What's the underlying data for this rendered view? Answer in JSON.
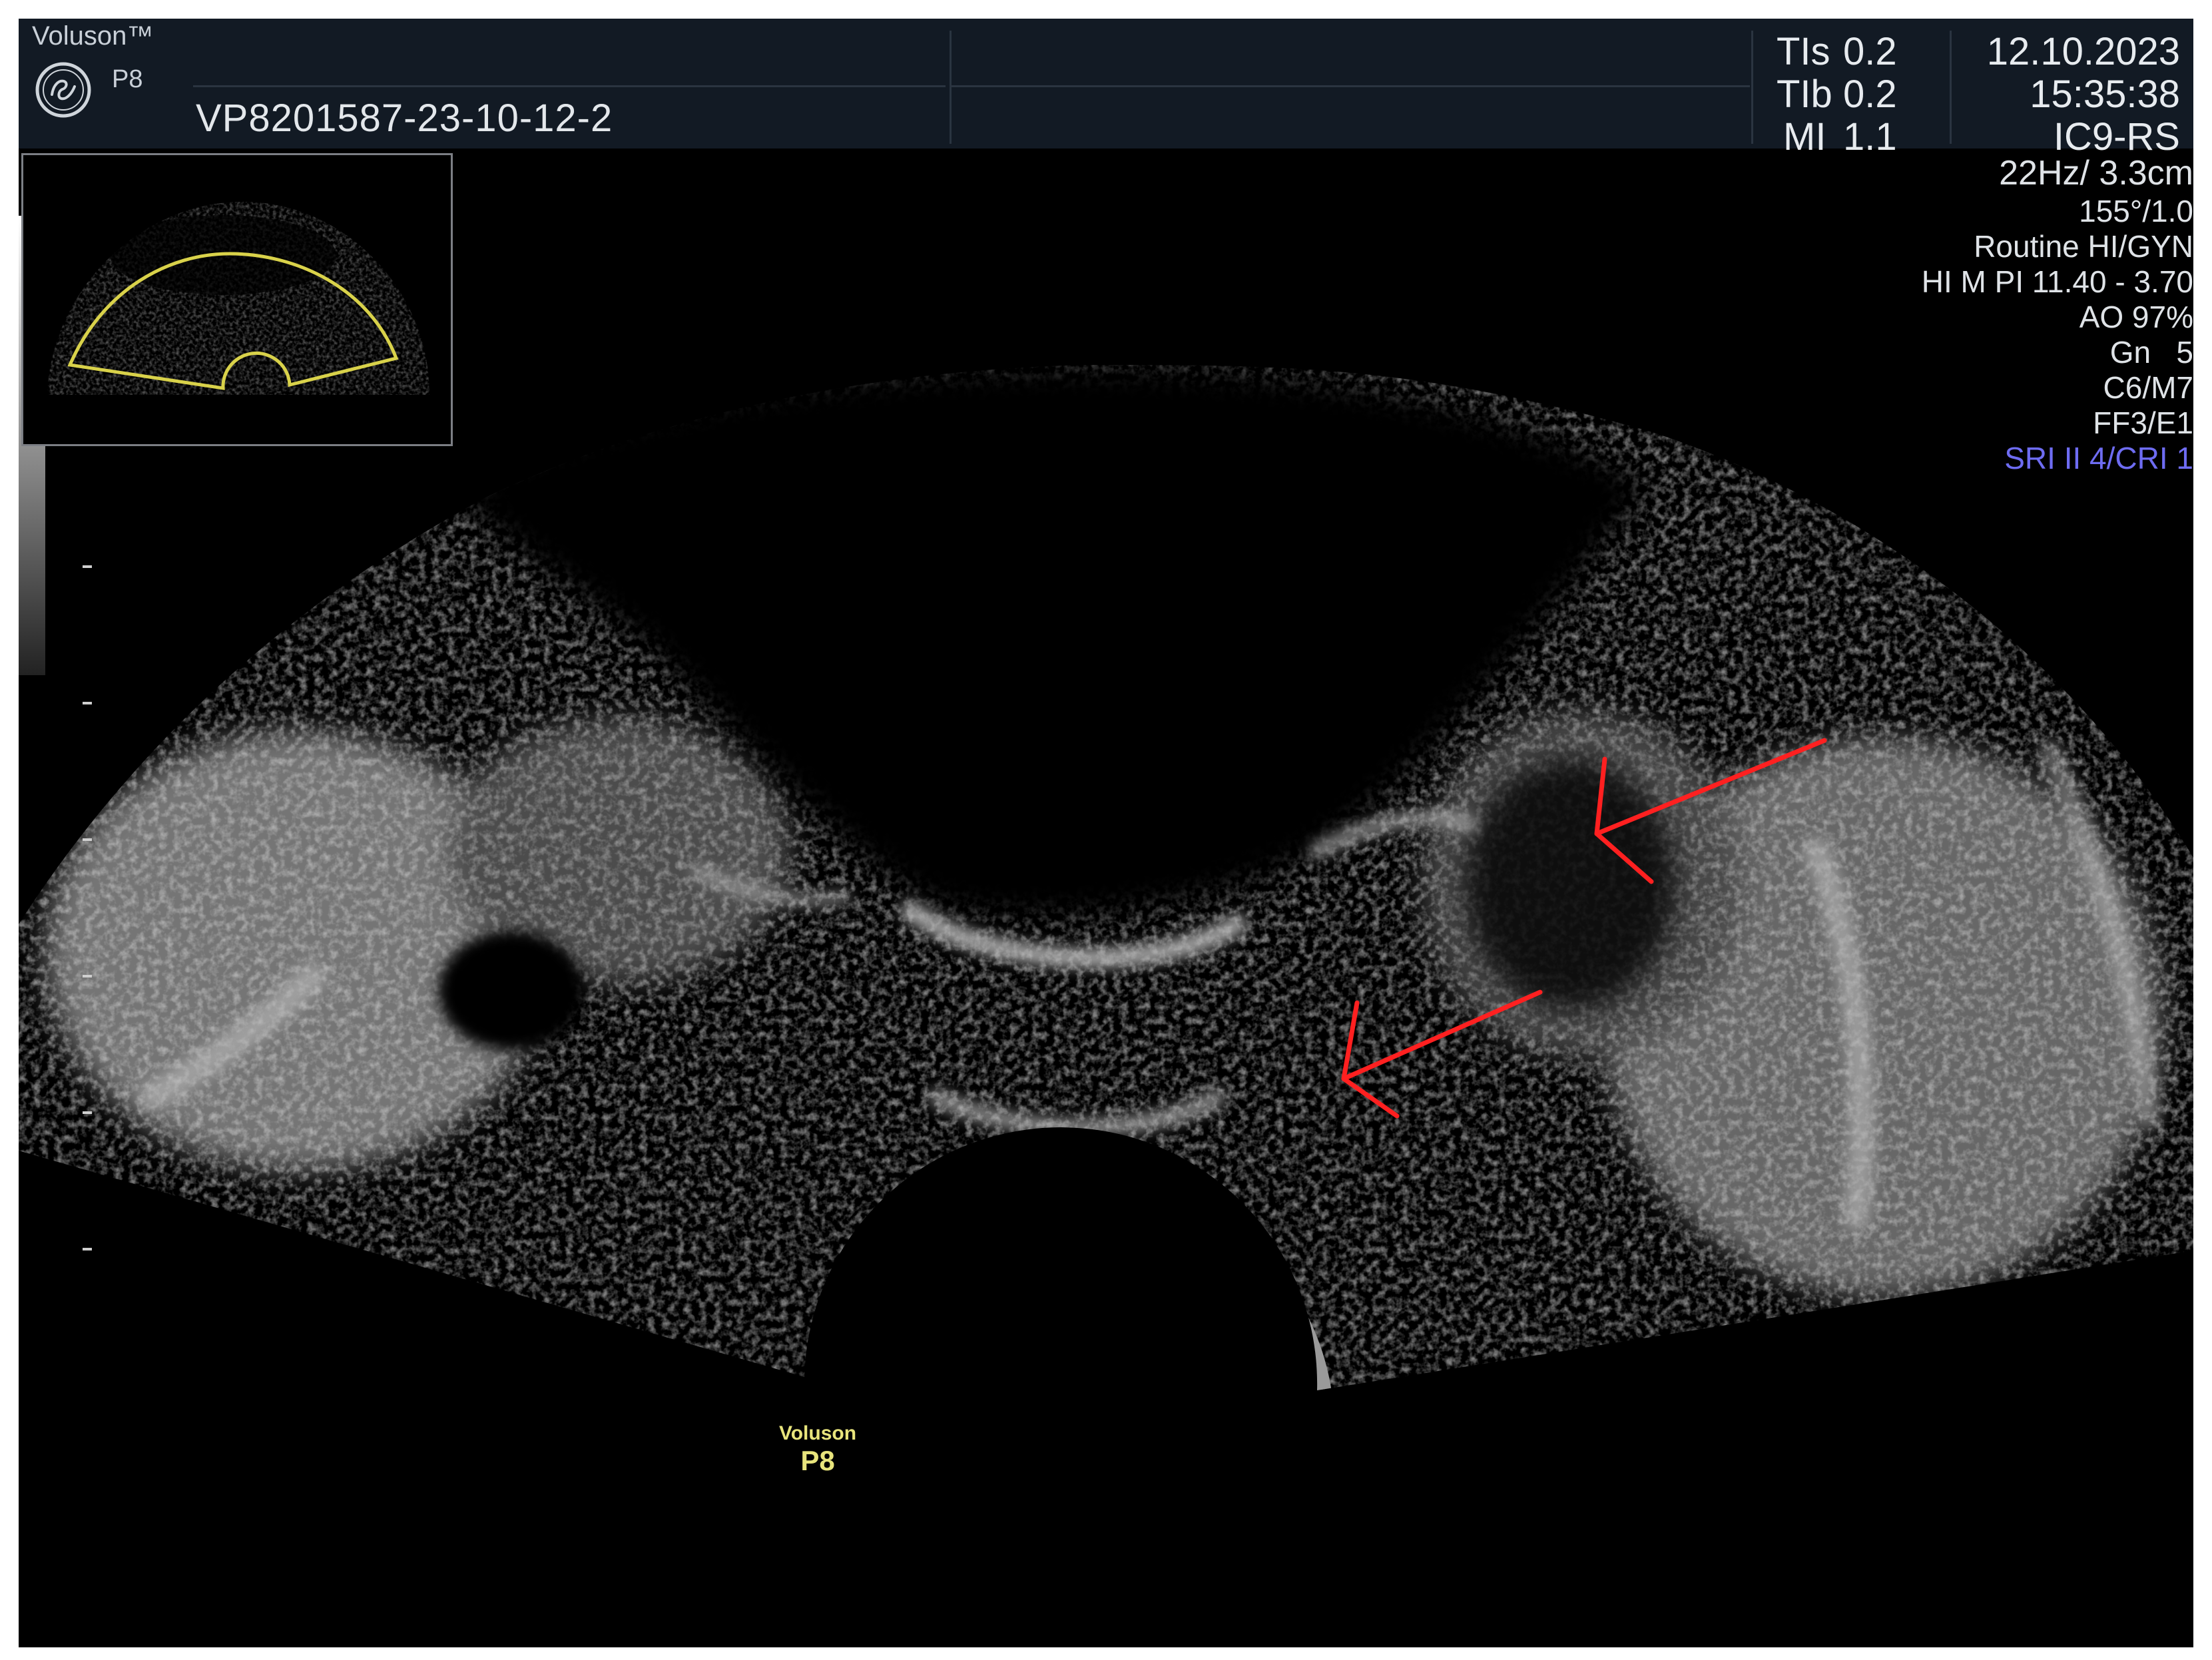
{
  "header": {
    "brand": "Voluson™",
    "probe_model": "P8",
    "patient_id": "VP8201587-23-10-12-2",
    "tis_label": "TIs",
    "tis_value": "0.2",
    "tib_label": "TIb",
    "tib_value": "0.2",
    "mi_label": "MI",
    "mi_value": "1.1",
    "date": "12.10.2023",
    "time": "15:35:38",
    "transducer": "IC9-RS"
  },
  "side_info": {
    "frequency_depth": "22Hz/ 3.3cm",
    "angle": "155°/1.0",
    "preset": "Routine HI/GYN",
    "harmonic": "HI M PI 11.40 - 3.70",
    "acoustic_output": "AO 97%",
    "gain": "Gn   5",
    "c_m": "C6/M7",
    "ff_e": "FF3/E1",
    "sri": "SRI II 4/CRI 1"
  },
  "probe_label": {
    "line1": "Voluson",
    "line2": "P8"
  },
  "colors": {
    "background": "#000000",
    "header_bg": "#121a24",
    "header_text": "#e7ebef",
    "sri_text": "#6e6cf2",
    "thumb_sector": "#d9d24a",
    "arrow": "#ff2020",
    "probe_label": "#e8e47c"
  },
  "icons": [
    "ge-logo-icon",
    "red-arrow-icon"
  ]
}
